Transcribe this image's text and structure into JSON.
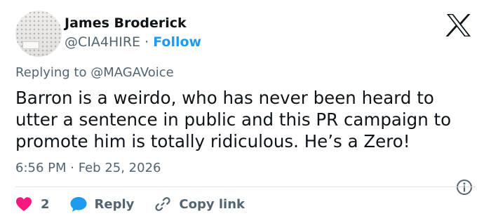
{
  "author": {
    "name": "James Broderick",
    "handle": "@CIA4HIRE",
    "separator": "·",
    "follow_label": "Follow"
  },
  "reply_context": {
    "prefix": "Replying to",
    "mention": "@MAGAVoice"
  },
  "tweet": {
    "lines": [
      "Barron is a weirdo, who has never been heard to",
      "utter a sentence in public and this PR campaign to",
      "promote him is totally ridiculous. He’s a Zero!"
    ]
  },
  "meta": {
    "time": "6:56 PM",
    "separator": "·",
    "date": "Feb 25, 2026"
  },
  "actions": {
    "like_count": "2",
    "reply_label": "Reply",
    "copy_label": "Copy link"
  },
  "icons": {
    "logo": "x-logo-icon",
    "info": "info-icon",
    "like": "heart-icon",
    "reply": "reply-bubble-icon",
    "copy": "link-icon"
  },
  "colors": {
    "text": "#0f1419",
    "secondary": "#536471",
    "accent": "#1d9bf0",
    "like": "#f91880",
    "divider": "#dbe2e7"
  }
}
